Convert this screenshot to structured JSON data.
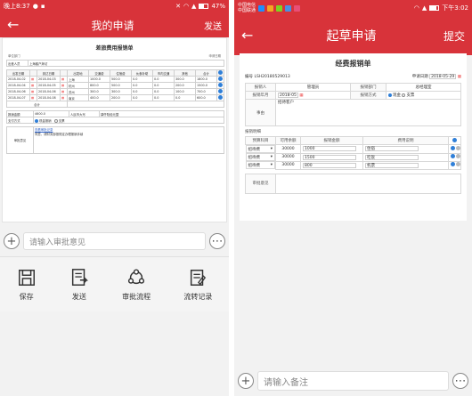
{
  "left": {
    "status": {
      "time": "晚上8:37",
      "battery": "47%",
      "battery_level": 0.47
    },
    "nav": {
      "back": "←",
      "title": "我的申请",
      "action": "发送"
    },
    "doc": {
      "title": "差旅费用报销单",
      "meta_left": "单位部门",
      "meta_right": "申请日期",
      "applicant_label": "出差人员",
      "applicant_value": "上海客户拜访",
      "columns": [
        "出发日期",
        "",
        "到达日期",
        "",
        "出发地",
        "交通费",
        "住宿费",
        "伙食补助",
        "市内交通",
        "其他",
        "合计",
        ""
      ],
      "rows": [
        [
          "2018-04-02",
          "",
          "2018-04-03",
          "",
          "上海",
          "1000.0",
          "500.0",
          "0.0",
          "0.0",
          "300.0",
          "1800.0",
          ""
        ],
        [
          "2018-04-04",
          "",
          "2018-04-05",
          "",
          "杭州",
          "800.0",
          "500.0",
          "0.0",
          "0.0",
          "200.0",
          "1500.0",
          ""
        ],
        [
          "2018-04-06",
          "",
          "2018-04-06",
          "",
          "苏州",
          "300.0",
          "300.0",
          "0.0",
          "0.0",
          "100.0",
          "700.0",
          ""
        ],
        [
          "2018-04-07",
          "",
          "2018-04-08",
          "",
          "南京",
          "400.0",
          "200.0",
          "0.0",
          "0.0",
          "0.0",
          "600.0",
          ""
        ]
      ],
      "total_label": "合计",
      "total_amount_label": "报销金额",
      "total_amount": "4600.0",
      "upper_label": "人民币大写",
      "upper_value": "肆仟陆佰元整",
      "pay_label": "支付方式",
      "pay_options": [
        "现金报销",
        "支票"
      ],
      "approve_label": "审批意见",
      "approve_link": "查看审批记录",
      "approve_text": "同意，请财务部按规定办理报销手续"
    },
    "comment_placeholder": "请输入审批意见",
    "actions": [
      {
        "label": "保存",
        "icon": "save-icon"
      },
      {
        "label": "发送",
        "icon": "send-icon"
      },
      {
        "label": "审批流程",
        "icon": "flow-icon"
      },
      {
        "label": "流转记录",
        "icon": "record-icon"
      }
    ]
  },
  "right": {
    "status": {
      "carrier1": "中国电信",
      "carrier2": "中国联通",
      "time": "下午3:02"
    },
    "nav": {
      "back": "←",
      "title": "起草申请",
      "action": "提交"
    },
    "form": {
      "title": "经费报销单",
      "no_label": "编号",
      "no_value": "LSH20180529013",
      "date_label": "申请日期",
      "date_value": "2018-05-29",
      "applicant_label": "报销人",
      "applicant_value": "管理员",
      "dept_label": "报销部门",
      "dept_value": "总经理室",
      "month_label": "报销年月",
      "month_value": "2018-05",
      "method_label": "报销方式",
      "method_options": [
        "现金",
        "支票"
      ],
      "reason_label": "事由",
      "reason_value": "招待客户",
      "detail_label": "报销明细",
      "detail_columns": [
        "预算科目",
        "可用余额",
        "报销金额",
        "费用说明"
      ],
      "detail_rows": [
        {
          "subject": "招待费",
          "balance": "30000",
          "amount": "1000",
          "note": "住宿"
        },
        {
          "subject": "招待费",
          "balance": "30000",
          "amount": "1500",
          "note": "吃饭"
        },
        {
          "subject": "招待费",
          "balance": "30000",
          "amount": "800",
          "note": "机票"
        }
      ],
      "approve_label": "审批意见"
    },
    "comment_placeholder": "请输入备注"
  }
}
